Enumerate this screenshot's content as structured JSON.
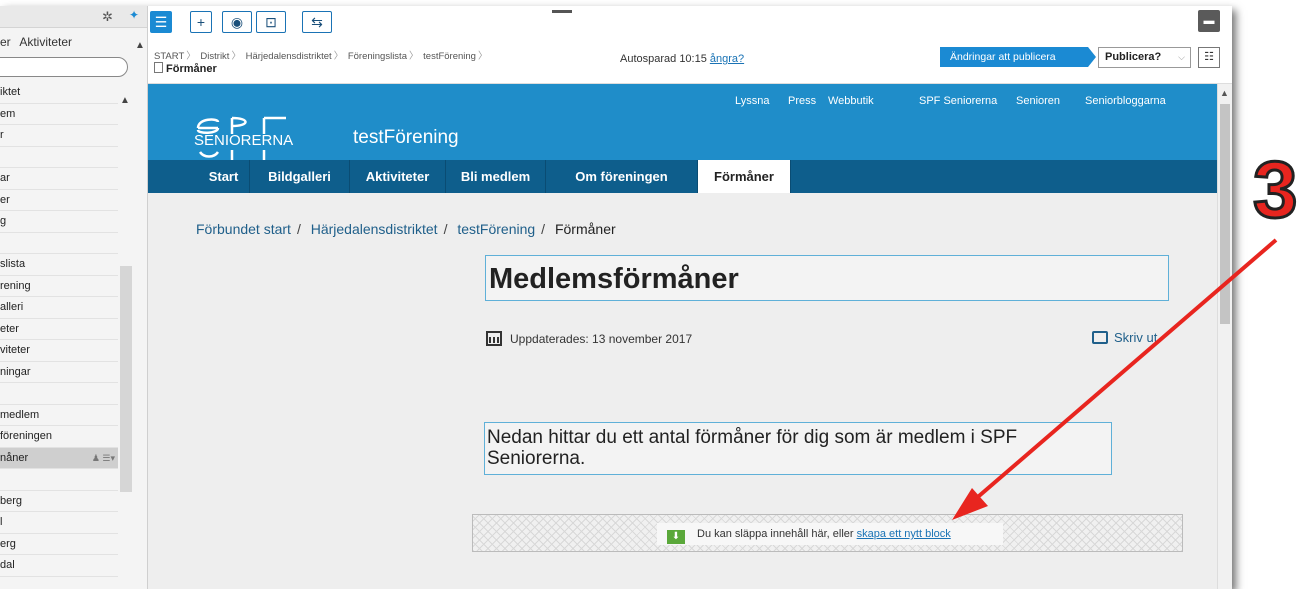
{
  "left_panel": {
    "tabs": [
      "er",
      "Aktiviteter"
    ],
    "search_placeholder": "",
    "tree": [
      "iktet",
      "em",
      "r",
      "",
      "ar",
      "er",
      "g",
      "",
      "slista",
      "rening",
      "alleri",
      "eter",
      "viteter",
      "ningar",
      "",
      "medlem",
      "föreningen",
      "nåner",
      "",
      "berg",
      "l",
      "erg",
      "dal"
    ],
    "selected_index": 17
  },
  "toolbar": {
    "buttons": [
      "tree-toggle",
      "add",
      "view",
      "preview",
      "compare"
    ]
  },
  "cms": {
    "breadcrumb": [
      "START",
      "Distrikt",
      "Härjedalensdistriktet",
      "Föreningslista",
      "testFörening"
    ],
    "page_name": "Förmåner",
    "autosave": "Autosparad 10:15",
    "undo": "ångra?",
    "changes": "Ändringar att publicera",
    "publish": "Publicera?"
  },
  "site": {
    "top_links": [
      "Lyssna",
      "Press",
      "Webbutik",
      "SPF Seniorerna",
      "Senioren",
      "Seniorbloggarna"
    ],
    "logo_text": "SENIORERNA",
    "site_name": "testFörening",
    "nav": [
      "Start",
      "Bildgalleri",
      "Aktiviteter",
      "Bli medlem",
      "Om föreningen",
      "Förmåner"
    ],
    "breadcrumb": [
      "Förbundet start",
      "Härjedalensdistriktet",
      "testFörening",
      "Förmåner"
    ],
    "title": "Medlemsförmåner",
    "updated": "Uppdaterades: 13 november 2017",
    "print": "Skriv ut",
    "intro": "Nedan hittar du ett antal förmåner för dig som är medlem i SPF Seniorerna.",
    "dropzone_text": "Du kan släppa innehåll här, eller",
    "dropzone_link": "skapa ett nytt block"
  },
  "annotation": {
    "number": "3",
    "color": "#e8251f"
  }
}
